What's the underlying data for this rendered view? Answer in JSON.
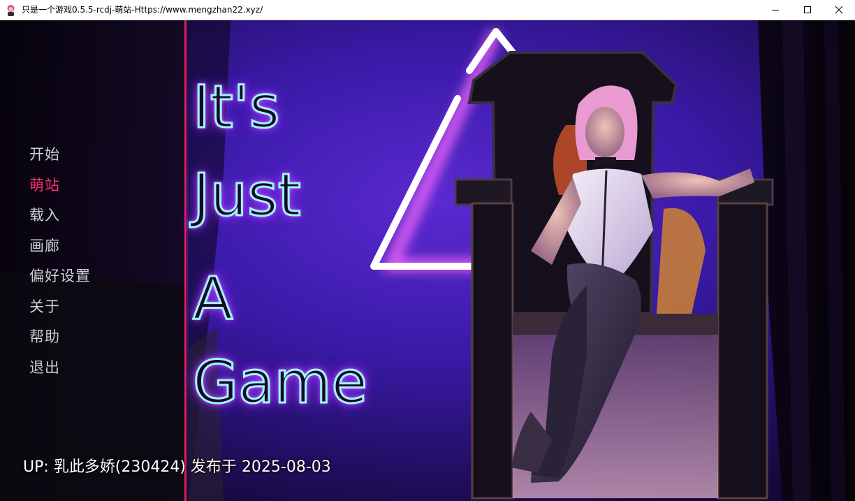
{
  "window": {
    "title": "只是一个游戏0.5.5-rcdj-萌站-Https://www.mengzhan22.xyz/",
    "app_icon": "app-character-icon",
    "controls": [
      "minimize-icon",
      "maximize-icon",
      "close-icon"
    ]
  },
  "game": {
    "title_lines": [
      "It's",
      "Just",
      "A",
      "Game"
    ],
    "neon_color": "#9ff4ff",
    "glow_color": "#b03cff",
    "accent_line_color": "#e0205a"
  },
  "menu": {
    "items": [
      {
        "label": "开始",
        "active": false
      },
      {
        "label": "萌站",
        "active": true
      },
      {
        "label": "载入",
        "active": false
      },
      {
        "label": "画廊",
        "active": false
      },
      {
        "label": "偏好设置",
        "active": false
      },
      {
        "label": "关于",
        "active": false
      },
      {
        "label": "帮助",
        "active": false
      },
      {
        "label": "退出",
        "active": false
      }
    ],
    "active_color": "#ff2f6e",
    "default_color": "#cfcfcf"
  },
  "footer": {
    "credit": "UP: 乳此多娇(230424) 发布于 2025-08-03"
  }
}
